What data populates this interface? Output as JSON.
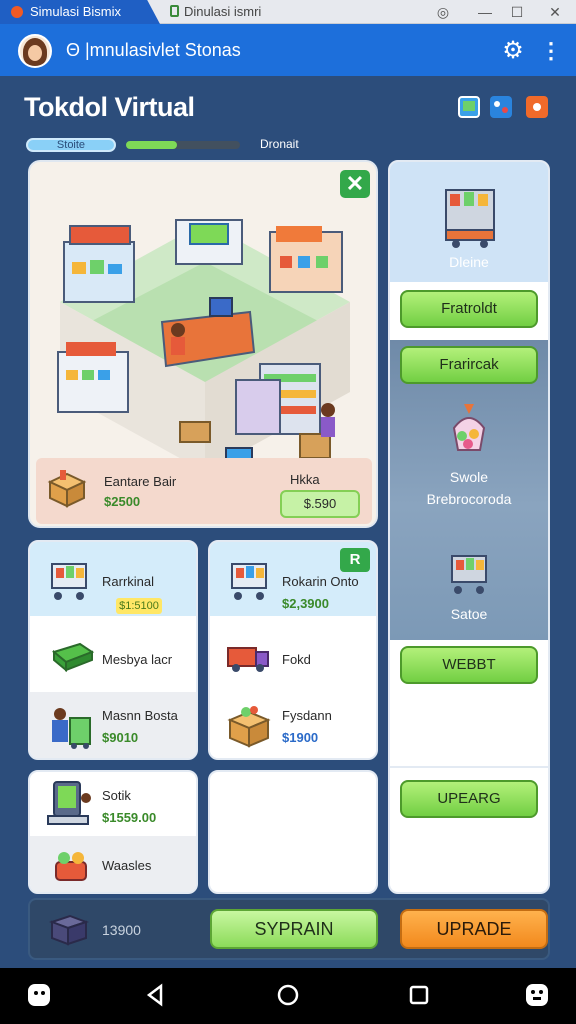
{
  "window": {
    "tab_active": "Simulasi Bismix",
    "tab_inactive": "Dinulasi ismri",
    "btn_restore": "◎",
    "btn_minimize": "—",
    "btn_maximize": "☐",
    "btn_close": "✕"
  },
  "appbar": {
    "title": "Θ |mnulasivlet Stonas",
    "gear_glyph": "⚙",
    "menu_glyph": "⋮"
  },
  "header": {
    "title": "Tokdol Virtual",
    "progress_label": "Stoite",
    "progress_fill": 0.45,
    "progress_text": "Dronait"
  },
  "scene": {
    "close_glyph": "✕",
    "footer": {
      "item_title": "Eantare Bair",
      "item_price": "$2500",
      "label2": "Hkka",
      "btn_price": "$.590"
    }
  },
  "right": {
    "panel1_label": "Dleine",
    "btn1": "Fratroldt",
    "btn2": "Frarircak",
    "sweet_label_1": "Swole",
    "sweet_label_2": "Brebrocoroda",
    "sale_label": "Satoe",
    "btn3": "WEBBT",
    "btn4": "UPEARG"
  },
  "card_a": {
    "rows": [
      {
        "title": "Rarrkinal",
        "badge": "$1:5100"
      },
      {
        "title": "Mesbya lacr"
      },
      {
        "title": "Masnn Bosta",
        "price": "$9010"
      }
    ]
  },
  "card_b": {
    "green_glyph": "R",
    "rows": [
      {
        "title": "Rokarin Onto",
        "price": "$2,3900"
      },
      {
        "title": "Fokd"
      },
      {
        "title": "Fysdann",
        "price": "$1900"
      }
    ]
  },
  "card_c": {
    "rows": [
      {
        "title": "Sotik",
        "price": "$1559.00"
      },
      {
        "title": "Waasles"
      }
    ]
  },
  "bottom": {
    "text": "13900",
    "btn1": "SYPRAIN",
    "btn2": "UPRADE"
  },
  "colors": {
    "background": "#2c4d7b",
    "appbar": "#1d6fdb",
    "accent_green": "#7ed957",
    "accent_orange": "#f2891d"
  }
}
